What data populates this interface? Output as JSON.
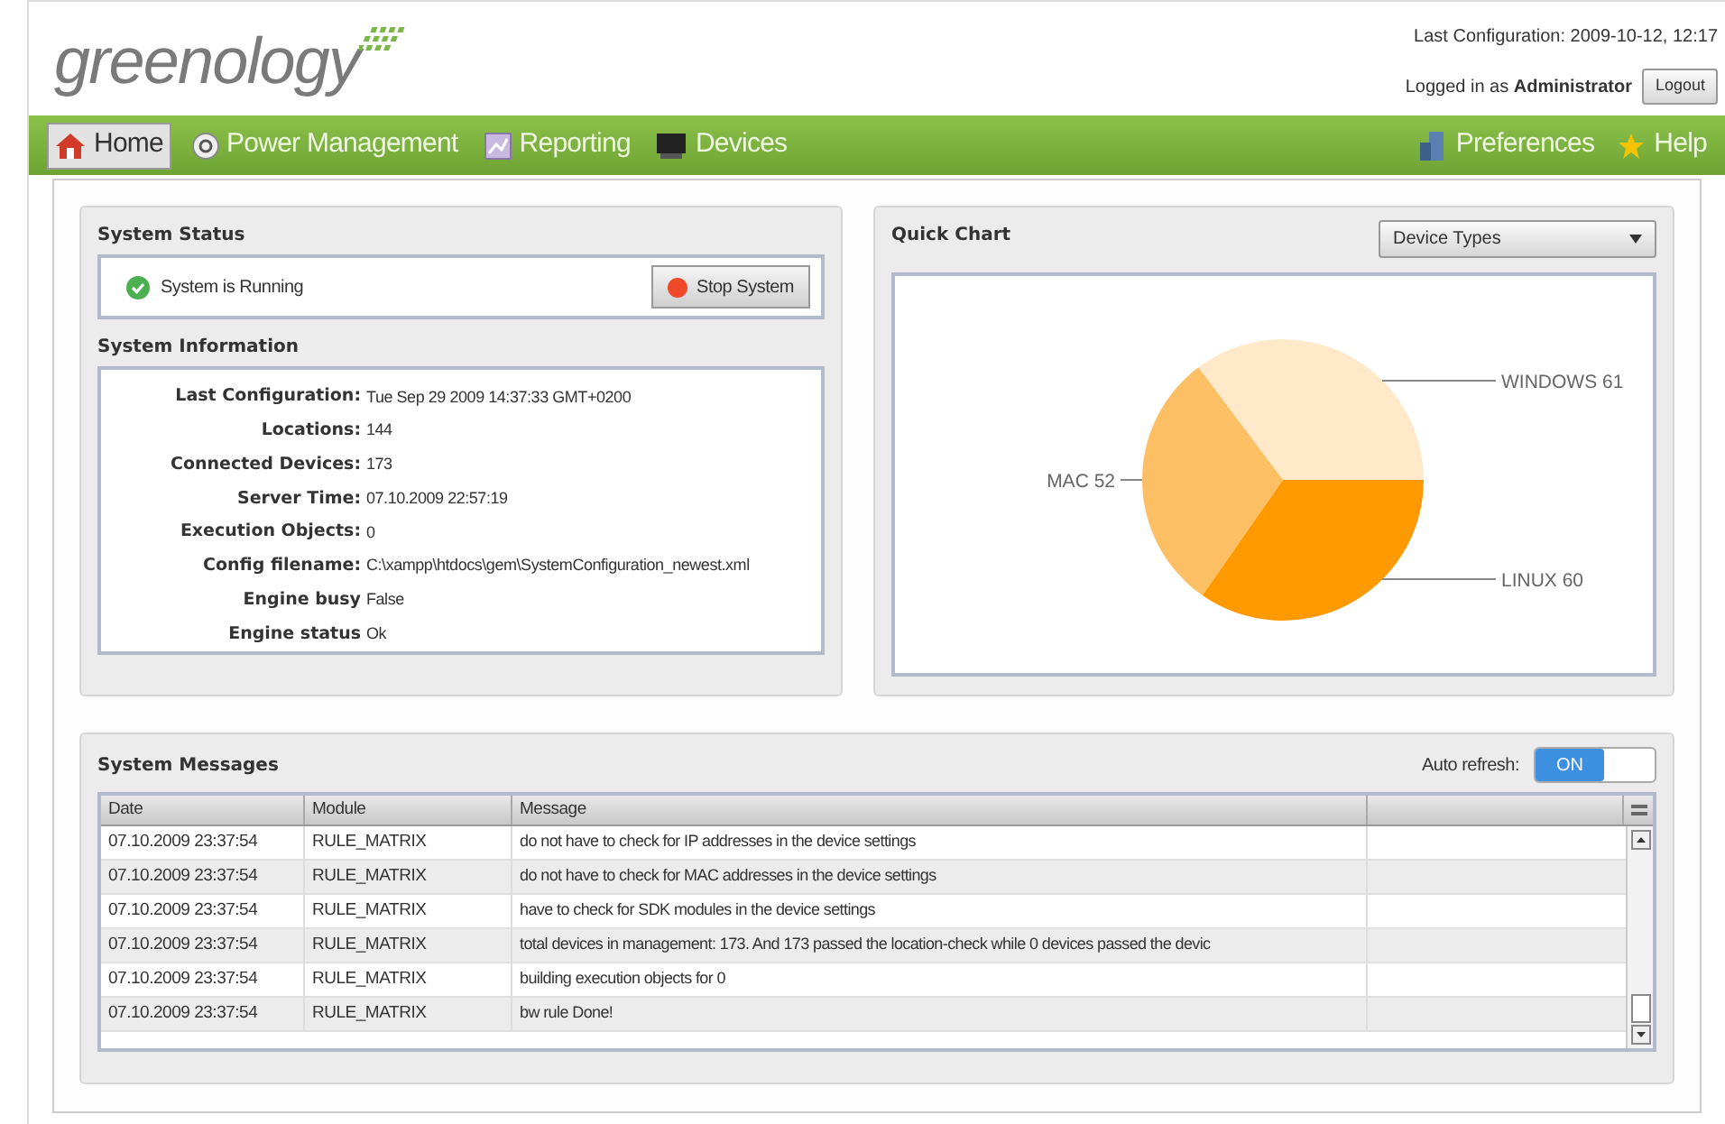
{
  "header": {
    "logo": "greenology",
    "last_configuration": "Last Configuration: 2009-10-12, 12:17",
    "logged_in": "Logged in as **Administrator**",
    "logout": "Logout"
  },
  "nav": {
    "left": [
      {
        "label": "Home",
        "selected": true
      },
      {
        "label": "Power Management",
        "selected": false
      },
      {
        "label": "Reporting",
        "selected": false
      },
      {
        "label": "Devices",
        "selected": false
      }
    ],
    "right": [
      {
        "label": "Preferences"
      },
      {
        "label": "Help"
      }
    ]
  },
  "system_status": {
    "title": "System Status",
    "status": "System is Running",
    "running": true,
    "button": "Stop System"
  },
  "system_information": {
    "title": "System Information",
    "rows": [
      {
        "label": "Last Configuration:",
        "value": "Tue Sep 29 2009 14:37:33 GMT+0200"
      },
      {
        "label": "Locations:",
        "value": "144"
      },
      {
        "label": "Connected Devices:",
        "value": "173"
      },
      {
        "label": "Server Time:",
        "value": "07.10.2009 22:57:19"
      },
      {
        "label": "Execution Objects:",
        "value": "0"
      },
      {
        "label": "Config filename:",
        "value": "C:\\xampp\\htdocs\\gem\\SystemConfiguration_newest.xml"
      },
      {
        "label": "Engine busy",
        "value": "False"
      },
      {
        "label": "Engine status",
        "value": "Ok"
      }
    ]
  },
  "quick_chart": {
    "title": "Quick Chart",
    "dropdown": "Device Types",
    "chart_data": {
      "type": "pie",
      "categories": [
        "WINDOWS 61",
        "MAC 52",
        "LINUX 60"
      ],
      "values": [
        61,
        52,
        60
      ],
      "colors": [
        "#ffe9c9",
        "#fdbf63",
        "#ff9900"
      ]
    }
  },
  "system_messages": {
    "title": "System Messages",
    "auto_refresh_label": "Auto refresh:",
    "auto_refresh": {
      "on": true,
      "label": "ON"
    },
    "columns": [
      "Date",
      "Module",
      "Message"
    ],
    "rows": [
      [
        "07.10.2009 23:37:54",
        "RULE_MATRIX",
        "do not have to check for IP addresses in the device settings"
      ],
      [
        "07.10.2009 23:37:54",
        "RULE_MATRIX",
        "do not have to check for MAC addresses in the device settings"
      ],
      [
        "07.10.2009 23:37:54",
        "RULE_MATRIX",
        "have to check for SDK modules in the device settings"
      ],
      [
        "07.10.2009 23:37:54",
        "RULE_MATRIX",
        "total devices in management: 173. And 173 passed the location-check while 0 devices passed the devic"
      ],
      [
        "07.10.2009 23:37:54",
        "RULE_MATRIX",
        "building execution objects for 0"
      ],
      [
        "07.10.2009 23:37:54",
        "RULE_MATRIX",
        "bw rule Done!"
      ]
    ]
  }
}
